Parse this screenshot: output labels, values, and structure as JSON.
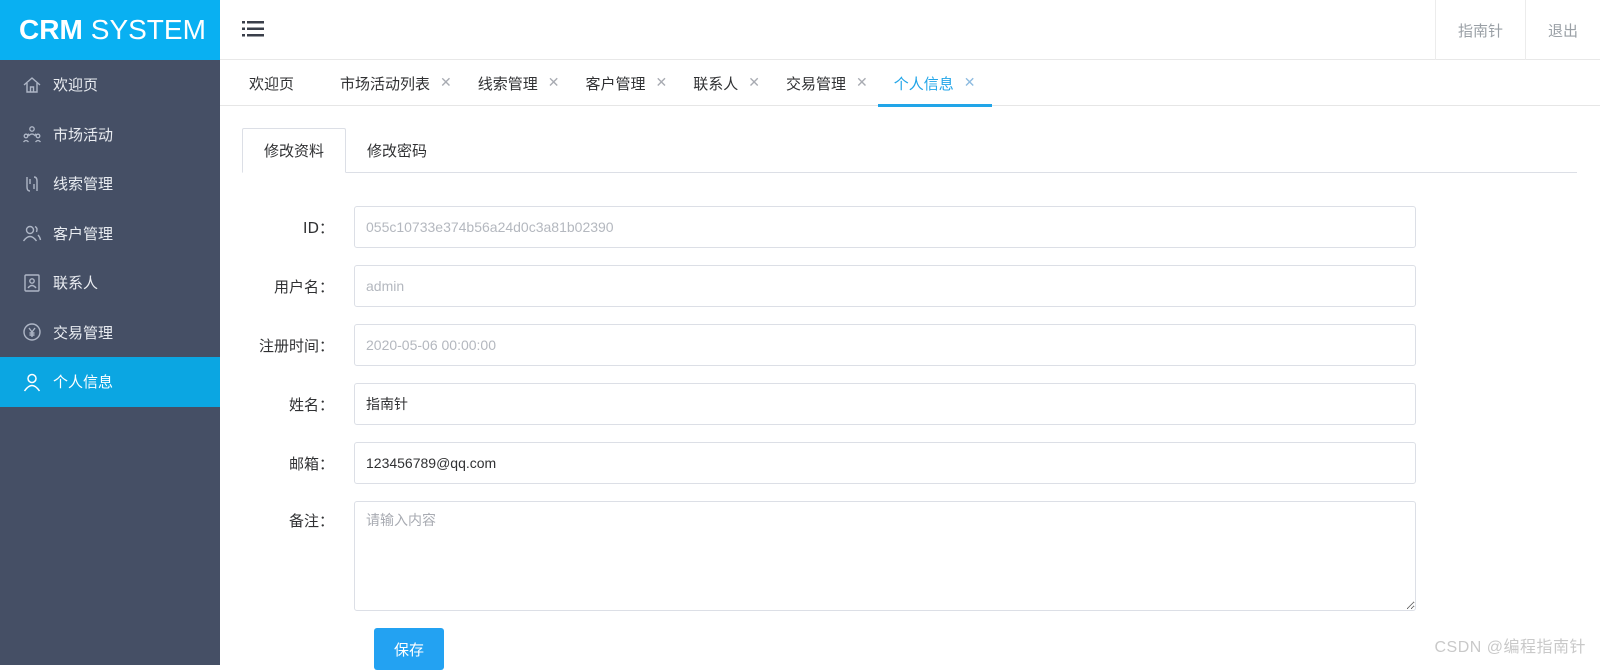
{
  "app": {
    "logo_bold": "CRM",
    "logo_rest": "SYSTEM"
  },
  "sidebar": {
    "items": [
      {
        "label": "欢迎页",
        "icon": "home-icon"
      },
      {
        "label": "市场活动",
        "icon": "people-network-icon"
      },
      {
        "label": "线索管理",
        "icon": "clue-link-icon"
      },
      {
        "label": "客户管理",
        "icon": "customer-icon"
      },
      {
        "label": "联系人",
        "icon": "contact-card-icon"
      },
      {
        "label": "交易管理",
        "icon": "yen-icon"
      },
      {
        "label": "个人信息",
        "icon": "user-icon",
        "active": true
      }
    ]
  },
  "header": {
    "user_name": "指南针",
    "logout": "退出",
    "menu_icon": "hamburger-icon"
  },
  "tabs": [
    {
      "label": "欢迎页",
      "closable": false
    },
    {
      "label": "市场活动列表",
      "closable": true
    },
    {
      "label": "线索管理",
      "closable": true
    },
    {
      "label": "客户管理",
      "closable": true
    },
    {
      "label": "联系人",
      "closable": true
    },
    {
      "label": "交易管理",
      "closable": true
    },
    {
      "label": "个人信息",
      "closable": true,
      "active": true
    }
  ],
  "tab_close_glyph": "✕",
  "subtabs": [
    {
      "label": "修改资料",
      "active": true
    },
    {
      "label": "修改密码"
    }
  ],
  "form": {
    "id": {
      "label": "ID：",
      "value": "055c10733e374b56a24d0c3a81b02390"
    },
    "username": {
      "label": "用户名：",
      "value": "admin"
    },
    "register_time": {
      "label": "注册时间：",
      "value": "2020-05-06 00:00:00"
    },
    "name": {
      "label": "姓名：",
      "value": "指南针"
    },
    "email": {
      "label": "邮箱：",
      "value": "123456789@qq.com"
    },
    "remark": {
      "label": "备注：",
      "placeholder": "请输入内容"
    },
    "save": "保存"
  },
  "watermark": "CSDN @编程指南针",
  "colors": {
    "sidebar_bg": "#454f65",
    "accent": "#09b0f2",
    "active_item": "#0ba6e2",
    "button": "#23a2f2"
  }
}
